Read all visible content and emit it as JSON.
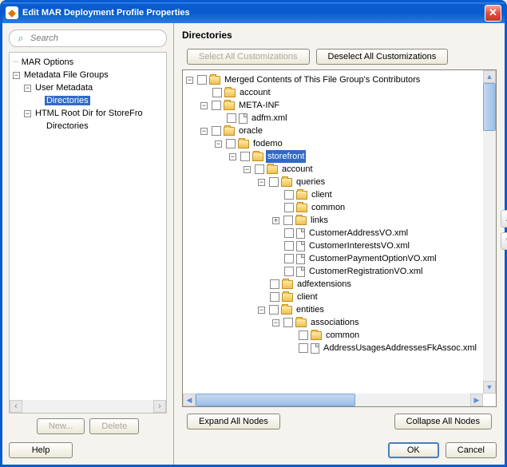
{
  "window": {
    "title": "Edit MAR Deployment Profile Properties"
  },
  "left": {
    "search_placeholder": "Search",
    "nav": {
      "mar_options": "MAR Options",
      "metadata_file_groups": "Metadata File Groups",
      "user_metadata": "User Metadata",
      "directories1": "Directories",
      "html_root": "HTML Root Dir for StoreFro",
      "directories2": "Directories"
    },
    "new_btn": "New...",
    "delete_btn": "Delete",
    "help_btn": "Help"
  },
  "right": {
    "title": "Directories",
    "select_all": "Select All Customizations",
    "deselect_all": "Deselect All Customizations",
    "expand_all": "Expand All Nodes",
    "collapse_all": "Collapse All Nodes",
    "tree": {
      "root": "Merged Contents of This File Group's Contributors",
      "account": "account",
      "meta_inf": "META-INF",
      "adfm_xml": "adfm.xml",
      "oracle": "oracle",
      "fodemo": "fodemo",
      "storefront": "storefront",
      "account2": "account",
      "queries": "queries",
      "client": "client",
      "common": "common",
      "links": "links",
      "cust_addr": "CustomerAddressVO.xml",
      "cust_int": "CustomerInterestsVO.xml",
      "cust_pay": "CustomerPaymentOptionVO.xml",
      "cust_reg": "CustomerRegistrationVO.xml",
      "adfextensions": "adfextensions",
      "client2": "client",
      "entities": "entities",
      "associations": "associations",
      "common2": "common",
      "addr_usages": "AddressUsagesAddressesFkAssoc.xml"
    }
  },
  "footer": {
    "ok": "OK",
    "cancel": "Cancel"
  }
}
